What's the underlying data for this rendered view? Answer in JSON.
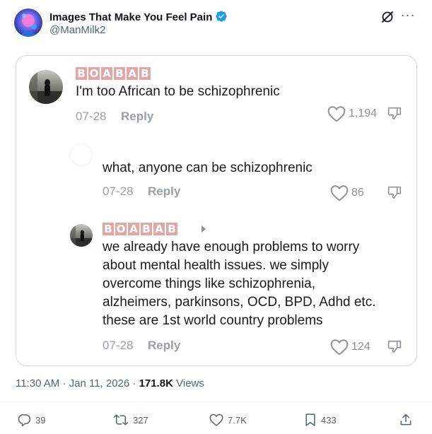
{
  "author": {
    "name": "Images That Make You Feel Pain",
    "handle": "@ManMilk2"
  },
  "embedded_thread": {
    "comment1": {
      "username_letters": [
        "B",
        "O",
        "A",
        "B",
        "A",
        "B"
      ],
      "text": "I'm too African to be schizophrenic",
      "date": "07-28",
      "reply_label": "Reply",
      "likes": "1,194"
    },
    "comment2": {
      "text": "what, anyone can be schizophrenic",
      "date": "07-28",
      "reply_label": "Reply",
      "likes": "86"
    },
    "comment3": {
      "username_letters": [
        "B",
        "O",
        "A",
        "B",
        "A",
        "B"
      ],
      "text_lines": [
        "we already have enough problems to worry",
        "about mental health issues. we simply",
        "overcome things like schizophrenia,",
        "alzheimers, parkinsons, OCD, BPD, Adhd etc.",
        "these are 1st world country problems"
      ],
      "date": "07-28",
      "reply_label": "Reply",
      "likes": "124"
    }
  },
  "meta": {
    "time": "11:30 AM",
    "separator": "·",
    "date": "Jan 11, 2026",
    "views_count": "171.8K",
    "views_label": "Views"
  },
  "actions": {
    "replies": "39",
    "reposts": "327",
    "likes": "7.7K",
    "bookmarks": "433"
  },
  "colors": {
    "verified": "#1d9bf0",
    "username_badge": "#e3a7a3",
    "secondary_text": "#536471"
  }
}
